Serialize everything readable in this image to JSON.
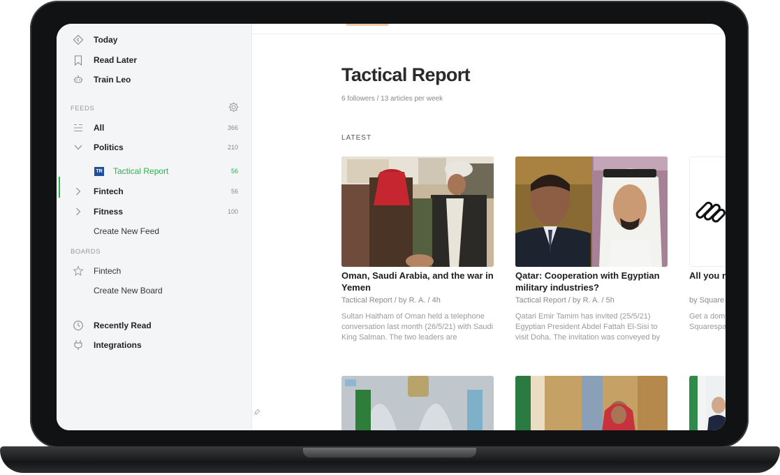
{
  "sidebar": {
    "nav": [
      {
        "label": "Today",
        "icon": "today-icon"
      },
      {
        "label": "Read Later",
        "icon": "bookmark-icon"
      },
      {
        "label": "Train Leo",
        "icon": "leo-icon"
      }
    ],
    "feeds_header": "FEEDS",
    "feeds": [
      {
        "label": "All",
        "count": "366"
      },
      {
        "label": "Politics",
        "count": "210"
      },
      {
        "label": "Tactical Report",
        "count": "56",
        "badge": "TR"
      },
      {
        "label": "Fintech",
        "count": "56"
      },
      {
        "label": "Fitness",
        "count": "100"
      }
    ],
    "create_feed": "Create New Feed",
    "boards_header": "BOARDS",
    "boards": [
      {
        "label": "Fintech"
      }
    ],
    "create_board": "Create New Board",
    "bottom": [
      {
        "label": "Recently Read",
        "icon": "clock-icon"
      },
      {
        "label": "Integrations",
        "icon": "plug-icon"
      }
    ],
    "accent_color": "#2bb24c"
  },
  "main": {
    "title": "Tactical Report",
    "meta": "6 followers / 13 articles per week",
    "section": "LATEST",
    "articles": [
      {
        "title": "Oman, Saudi Arabia, and the war in Yemen",
        "byline": "Tactical Report / by R. A. / 4h",
        "summary": "Sultan Haitham of Oman held a telephone conversation last month (26/5/21) with Saudi King Salman. The two leaders are"
      },
      {
        "title": "Qatar: Cooperation with Egyptian military industries?",
        "byline": "Tactical Report / by R. A. / 5h",
        "summary": "Qatari Emir Tamim has invited (25/5/21) Egyptian President Abdel Fattah El-Sisi to visit Doha. The invitation was conveyed by"
      },
      {
        "title": "All you n",
        "byline": "by Square",
        "summary": "Get a dom Squarespa"
      }
    ]
  }
}
